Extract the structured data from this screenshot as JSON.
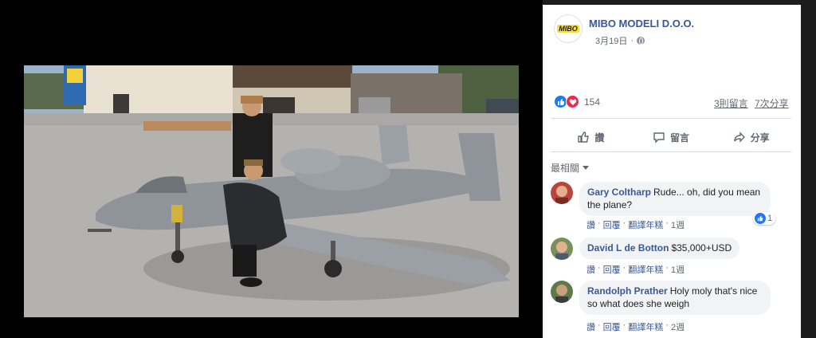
{
  "post": {
    "page_name": "MIBO MODELI D.O.O.",
    "logo_text": "MIBO",
    "date": "3月19日",
    "dot": "·",
    "reaction_count": "154",
    "comment_count": "3則留言",
    "share_count": "7次分享"
  },
  "actions": {
    "like": "讚",
    "comment": "留言",
    "share": "分享"
  },
  "sort": {
    "label": "最相關"
  },
  "comments": [
    {
      "author": "Gary Coltharp",
      "text": "Rude... oh, did you mean the plane?",
      "like": "讚",
      "reply": "回覆",
      "translate": "翻譯年糕",
      "sep": "·",
      "time": "1週",
      "reactions": "1"
    },
    {
      "author": "David L de Botton",
      "text": "$35,000+USD",
      "like": "讚",
      "reply": "回覆",
      "translate": "翻譯年糕",
      "sep": "·",
      "time": "1週"
    },
    {
      "author": "Randolph Prather",
      "text": "Holy moly that's nice so what does she weigh",
      "like": "讚",
      "reply": "回覆",
      "translate": "翻譯年糕",
      "sep": "·",
      "time": "2週"
    }
  ],
  "colors": {
    "link_blue": "#385898",
    "like_blue": "#2078f4",
    "love_red": "#f0284a",
    "panel_bg": "#ffffff",
    "viewer_bg": "#000000"
  }
}
